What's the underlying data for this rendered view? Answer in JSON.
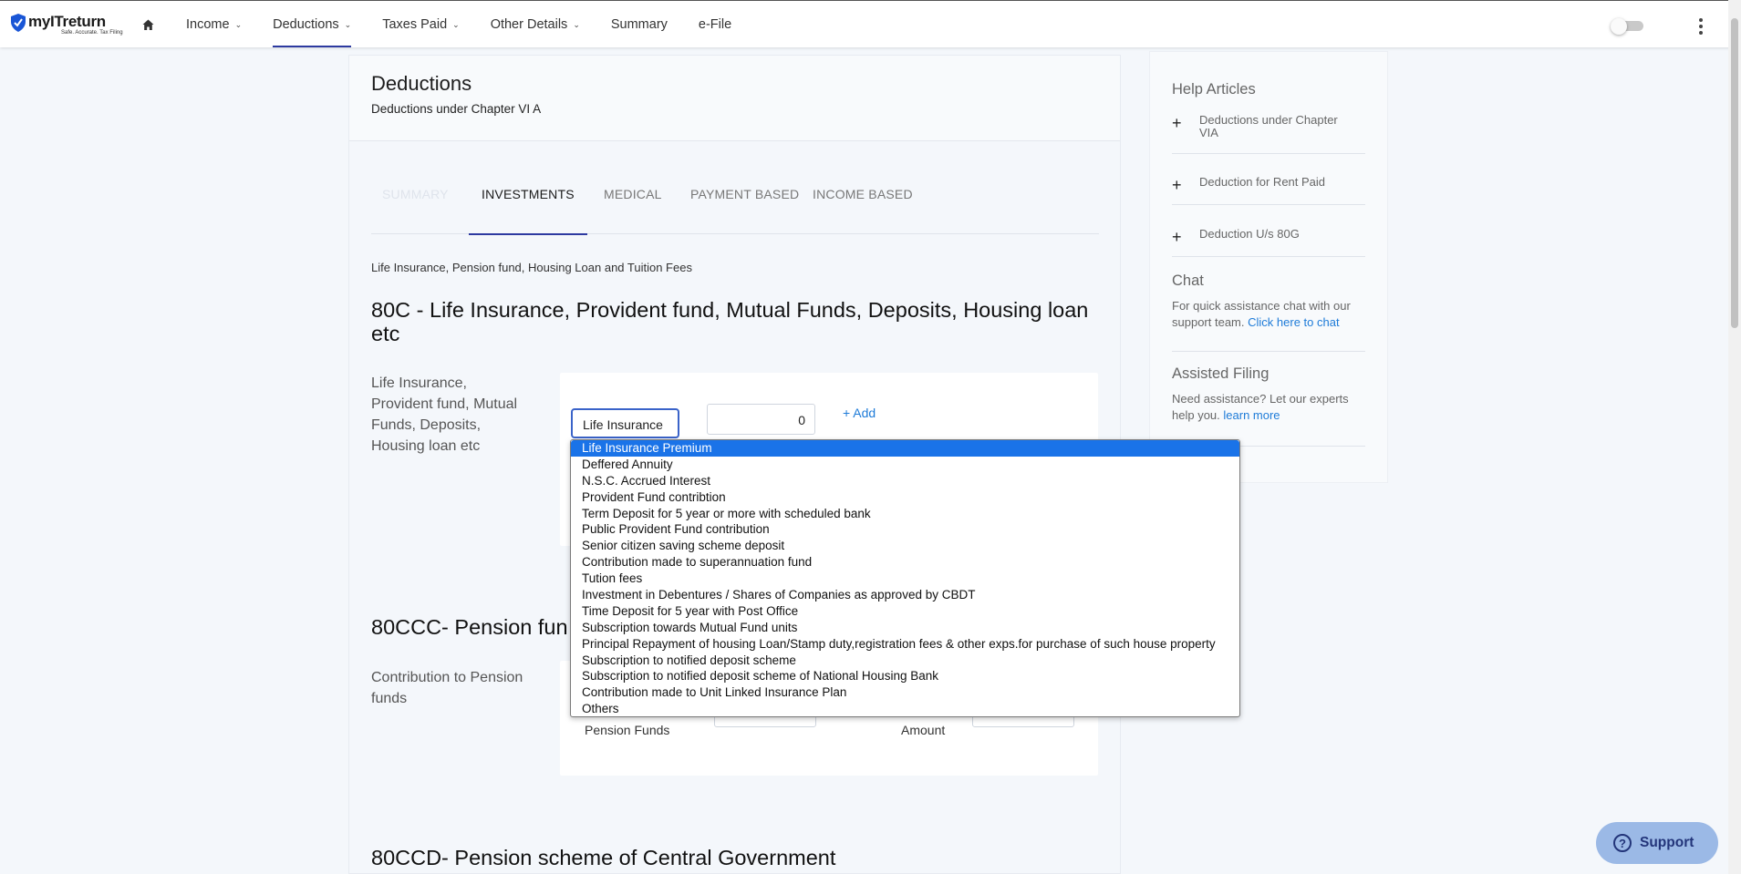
{
  "brand": {
    "name": "myITreturn",
    "tagline": "Safe. Accurate. Tax Filing",
    "accent": "#2d3aa0",
    "link_color": "#1e7bd8"
  },
  "nav": {
    "home_icon": "home-icon",
    "items": [
      {
        "label": "Income",
        "has_menu": true
      },
      {
        "label": "Deductions",
        "has_menu": true,
        "active": true
      },
      {
        "label": "Taxes Paid",
        "has_menu": true
      },
      {
        "label": "Other Details",
        "has_menu": true
      },
      {
        "label": "Summary",
        "has_menu": false
      },
      {
        "label": "e-File",
        "has_menu": false
      }
    ]
  },
  "page": {
    "title": "Deductions",
    "subtitle": "Deductions under Chapter VI A"
  },
  "tabs": [
    {
      "label": "SUMMARY",
      "state": "faded"
    },
    {
      "label": "INVESTMENTS",
      "state": "active"
    },
    {
      "label": "MEDICAL",
      "state": "normal"
    },
    {
      "label": "PAYMENT BASED",
      "state": "normal"
    },
    {
      "label": "INCOME BASED",
      "state": "normal"
    }
  ],
  "section80c": {
    "caption": "Life Insurance, Pension fund, Housing Loan and Tuition Fees",
    "title": "80C - Life Insurance, Provident fund, Mutual Funds, Deposits, Housing loan etc",
    "label": "Life Insurance, Provident fund, Mutual Funds, Deposits, Housing loan etc",
    "select_value": "Life Insurance",
    "amount_value": "0",
    "add_label": "+ Add"
  },
  "dropdown": {
    "selected_index": 0,
    "options": [
      "Life Insurance Premium",
      "Deffered Annuity",
      "N.S.C. Accrued Interest",
      "Provident Fund contribtion",
      "Term Deposit for 5 year or more with scheduled bank",
      "Public Provident Fund contribution",
      "Senior citizen saving scheme deposit",
      "Contribution made to superannuation fund",
      "Tution fees",
      "Investment in Debentures / Shares of Companies as approved by CBDT",
      "Time Deposit for 5 year with Post Office",
      "Subscription towards Mutual Fund units",
      "Principal Repayment of housing Loan/Stamp duty,registration fees & other exps.for purchase of such house property",
      "Subscription to notified deposit scheme",
      "Subscription to notified deposit scheme of National Housing Bank",
      "Contribution made to Unit Linked Insurance Plan",
      "Others"
    ]
  },
  "section80ccc": {
    "title": "80CCC- Pension fun",
    "label": "Contribution to Pension funds",
    "field1_label": "Pension Funds",
    "field2_label": "Amount"
  },
  "section80ccd": {
    "title": "80CCD- Pension scheme of Central Government"
  },
  "help": {
    "title": "Help Articles",
    "articles": [
      "Deductions under Chapter VIA",
      "Deduction for Rent Paid",
      "Deduction U/s 80G"
    ],
    "chat_title": "Chat",
    "chat_text": "For quick assistance chat with our support team.",
    "chat_link": "Click here to chat",
    "assist_title": "Assisted Filing",
    "assist_text": "Need assistance? Let our experts help you.",
    "assist_link": "learn more"
  },
  "support": {
    "label": "Support",
    "icon": "question-icon"
  }
}
